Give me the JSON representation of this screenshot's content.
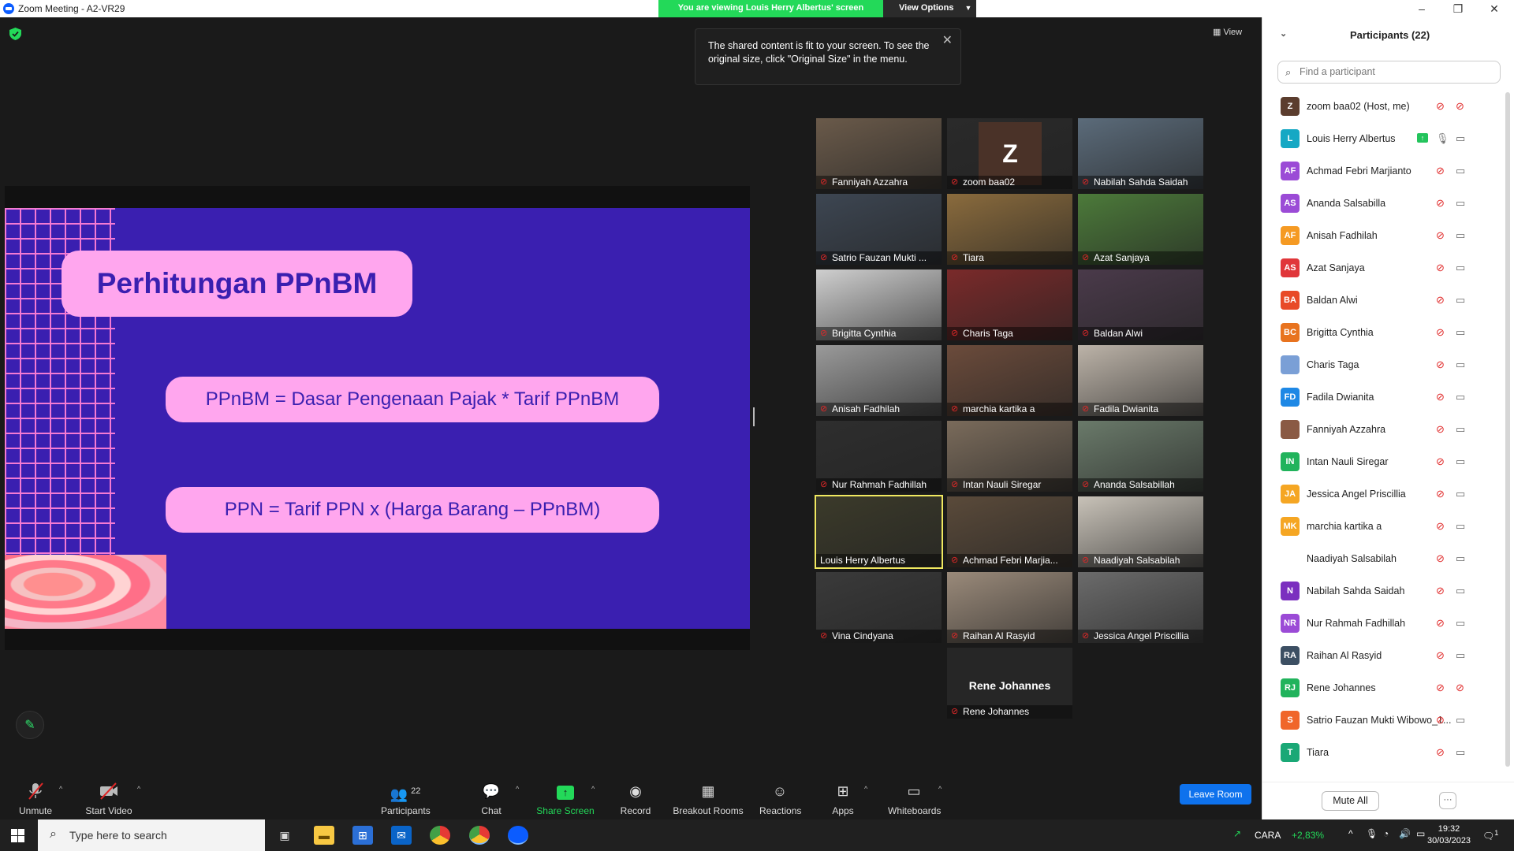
{
  "window": {
    "title": "Zoom Meeting - A2-VR29",
    "controls": [
      "–",
      "❐",
      "✕"
    ]
  },
  "banner": {
    "viewing": "You are viewing Louis Herry Albertus' screen",
    "view_options": "View Options"
  },
  "view_label": "View",
  "toast": {
    "text": "The shared content is fit to your screen. To see the original size, click \"Original Size\" in the menu."
  },
  "slide": {
    "title": "Perhitungan PPnBM",
    "formula1": "PPnBM = Dasar Pengenaan Pajak * Tarif PPnBM",
    "formula2": "PPN = Tarif PPN x (Harga Barang – PPnBM)"
  },
  "gallery": [
    {
      "name": "Fanniyah Azzahra",
      "muted": true
    },
    {
      "name": "zoom baa02",
      "muted": true,
      "avatar": "Z"
    },
    {
      "name": "Nabilah Sahda Saidah",
      "muted": true
    },
    {
      "name": "Satrio Fauzan Mukti ...",
      "muted": true
    },
    {
      "name": "Tiara",
      "muted": true
    },
    {
      "name": "Azat Sanjaya",
      "muted": true
    },
    {
      "name": "Brigitta Cynthia",
      "muted": true
    },
    {
      "name": "Charis Taga",
      "muted": true
    },
    {
      "name": "Baldan Alwi",
      "muted": true
    },
    {
      "name": "Anisah Fadhilah",
      "muted": true
    },
    {
      "name": "marchia kartika a",
      "muted": true
    },
    {
      "name": "Fadila Dwianita",
      "muted": true
    },
    {
      "name": "Nur Rahmah Fadhillah",
      "muted": true
    },
    {
      "name": "Intan Nauli Siregar",
      "muted": true
    },
    {
      "name": "Ananda Salsabillah",
      "muted": true
    },
    {
      "name": "Louis Herry Albertus",
      "muted": false,
      "active": true
    },
    {
      "name": "Achmad Febri Marjia...",
      "muted": true
    },
    {
      "name": "Naadiyah Salsabilah",
      "muted": true
    },
    {
      "name": "Vina Cindyana",
      "muted": true
    },
    {
      "name": "Raihan Al Rasyid",
      "muted": true
    },
    {
      "name": "Jessica Angel Priscillia",
      "muted": true
    },
    {
      "name": "Rene Johannes",
      "muted": true,
      "big_name": "Rene Johannes"
    }
  ],
  "toolbar": {
    "unmute": "Unmute",
    "start_video": "Start Video",
    "participants": "Participants",
    "participants_count": "22",
    "chat": "Chat",
    "share_screen": "Share Screen",
    "record": "Record",
    "breakout_rooms": "Breakout Rooms",
    "reactions": "Reactions",
    "apps": "Apps",
    "whiteboards": "Whiteboards",
    "leave_room": "Leave Room"
  },
  "panel": {
    "title": "Participants (22)",
    "search_placeholder": "Find a participant",
    "mute_all": "Mute All",
    "more": "···",
    "participants": [
      {
        "initials": "Z",
        "color": "#5b3d2e",
        "name": "zoom baa02 (Host, me)",
        "cam_off": true
      },
      {
        "initials": "L",
        "color": "#15a8c4",
        "name": "Louis Herry Albertus",
        "sharing": true
      },
      {
        "initials": "AF",
        "color": "#9b4bd6",
        "name": "Achmad Febri Marjianto"
      },
      {
        "initials": "AS",
        "color": "#9b4bd6",
        "name": "Ananda Salsabilla"
      },
      {
        "initials": "AF",
        "color": "#f59a23",
        "name": "Anisah Fadhilah"
      },
      {
        "initials": "AS",
        "color": "#e0363a",
        "name": "Azat Sanjaya"
      },
      {
        "initials": "BA",
        "color": "#e84a27",
        "name": "Baldan Alwi"
      },
      {
        "initials": "BC",
        "color": "#e8731f",
        "name": "Brigitta Cynthia"
      },
      {
        "initials": "",
        "color": "#7a9fd6",
        "name": "Charis Taga"
      },
      {
        "initials": "FD",
        "color": "#1e88e5",
        "name": "Fadila Dwianita"
      },
      {
        "initials": "",
        "color": "#8a5a44",
        "name": "Fanniyah Azzahra"
      },
      {
        "initials": "IN",
        "color": "#21b35c",
        "name": "Intan Nauli Siregar"
      },
      {
        "initials": "JA",
        "color": "#f5a623",
        "name": "Jessica Angel Priscillia"
      },
      {
        "initials": "MK",
        "color": "#f5a623",
        "name": "marchia kartika a"
      },
      {
        "initials": "",
        "color": "#ffffff",
        "name": "Naadiyah Salsabilah"
      },
      {
        "initials": "N",
        "color": "#7b2fbf",
        "name": "Nabilah Sahda Saidah"
      },
      {
        "initials": "NR",
        "color": "#9b4bd6",
        "name": "Nur Rahmah Fadhillah"
      },
      {
        "initials": "RA",
        "color": "#3c4f63",
        "name": "Raihan Al Rasyid"
      },
      {
        "initials": "RJ",
        "color": "#21b35c",
        "name": "Rene Johannes",
        "cam_off": true
      },
      {
        "initials": "S",
        "color": "#f0662a",
        "name": "Satrio Fauzan Mukti Wibowo_1..."
      },
      {
        "initials": "T",
        "color": "#1aa876",
        "name": "Tiara"
      }
    ]
  },
  "taskbar": {
    "search_placeholder": "Type here to search",
    "stock_name": "CARA",
    "stock_change": "+2,83%",
    "time": "19:32",
    "date": "30/03/2023",
    "notifications": "1"
  }
}
